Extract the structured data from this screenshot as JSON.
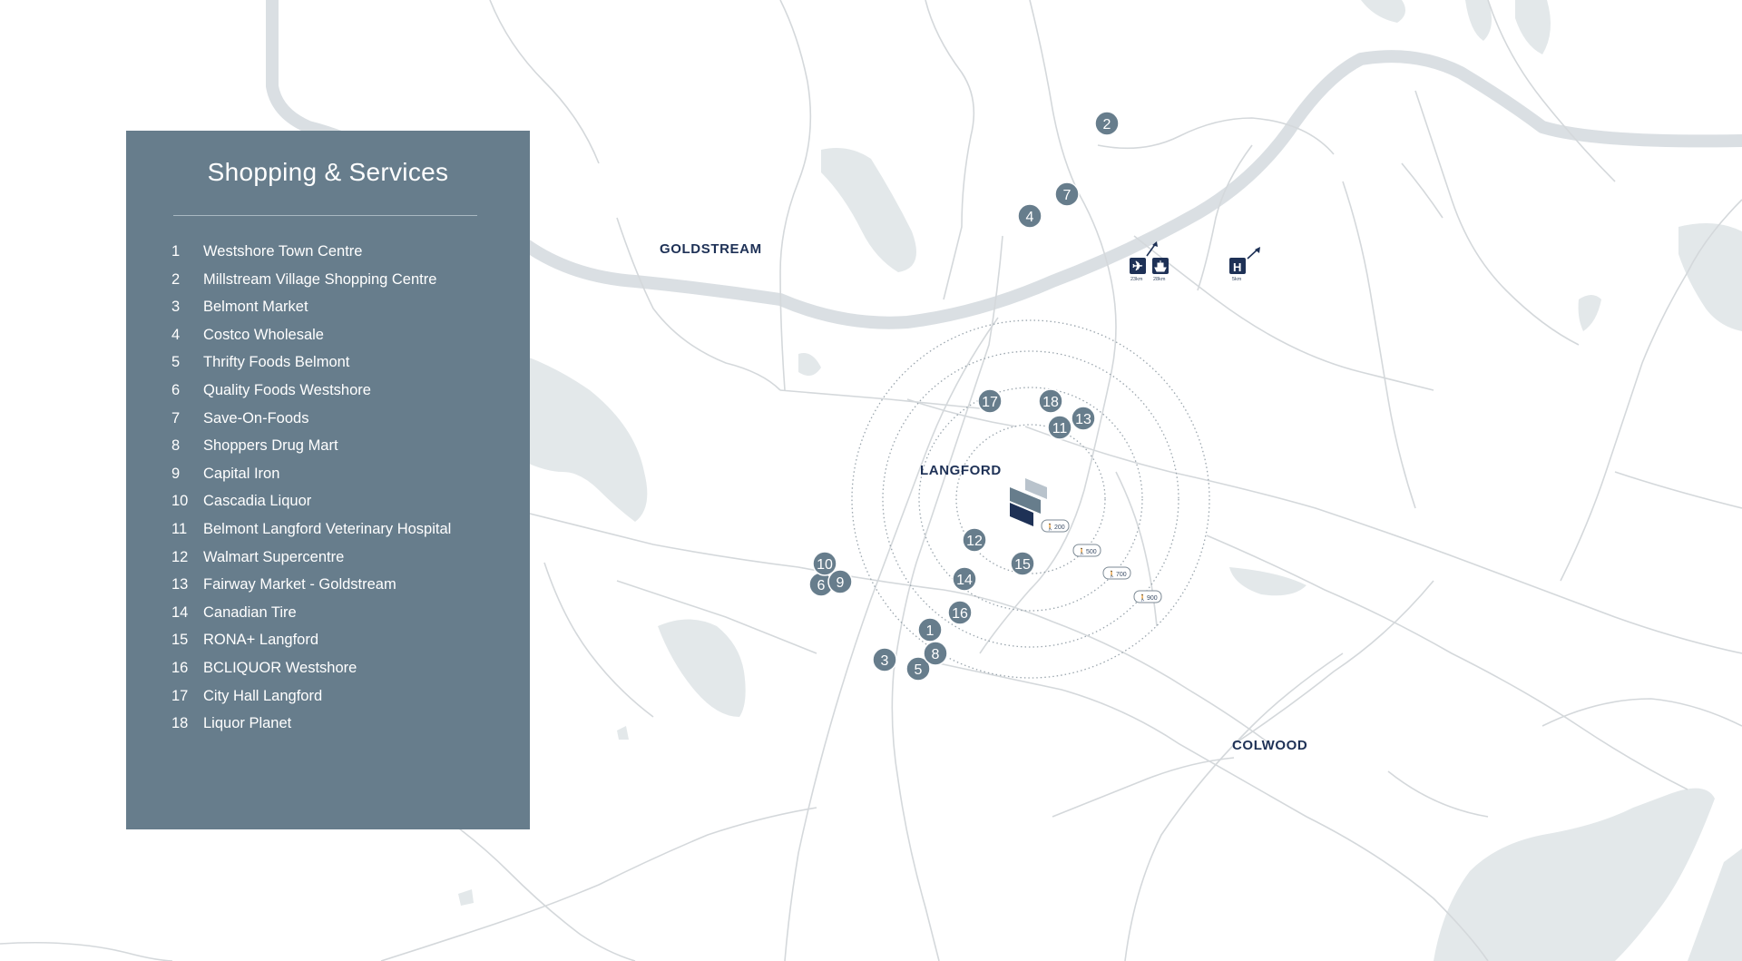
{
  "panel": {
    "title": "Shopping & Services",
    "items": [
      {
        "num": "1",
        "name": "Westshore Town Centre"
      },
      {
        "num": "2",
        "name": "Millstream Village Shopping Centre"
      },
      {
        "num": "3",
        "name": "Belmont Market"
      },
      {
        "num": "4",
        "name": "Costco Wholesale"
      },
      {
        "num": "5",
        "name": "Thrifty Foods Belmont"
      },
      {
        "num": "6",
        "name": "Quality Foods Westshore"
      },
      {
        "num": "7",
        "name": "Save-On-Foods"
      },
      {
        "num": "8",
        "name": "Shoppers Drug Mart"
      },
      {
        "num": "9",
        "name": "Capital Iron"
      },
      {
        "num": "10",
        "name": "Cascadia Liquor"
      },
      {
        "num": "11",
        "name": "Belmont Langford Veterinary Hospital"
      },
      {
        "num": "12",
        "name": "Walmart Supercentre"
      },
      {
        "num": "13",
        "name": "Fairway Market - Goldstream"
      },
      {
        "num": "14",
        "name": "Canadian Tire"
      },
      {
        "num": "15",
        "name": "RONA+ Langford"
      },
      {
        "num": "16",
        "name": "BCLIQUOR Westshore"
      },
      {
        "num": "17",
        "name": "City Hall Langford"
      },
      {
        "num": "18",
        "name": "Liquor Planet"
      }
    ]
  },
  "map": {
    "areas": {
      "goldstream": "GOLDSTREAM",
      "langford": "LANGFORD",
      "colwood": "COLWOOD"
    },
    "walk_rings": {
      "r200": "200",
      "r500": "500",
      "r700": "700",
      "r900": "900"
    },
    "facilities": {
      "airport_distance": "23km",
      "ferry_distance": "28km",
      "hospital_distance": "5km",
      "hospital_letter": "H"
    },
    "colors": {
      "panel": "#677d8c",
      "marker": "#677d8c",
      "label": "#1e3156",
      "road": "#d4d8db",
      "water": "#e3e8ea"
    }
  }
}
